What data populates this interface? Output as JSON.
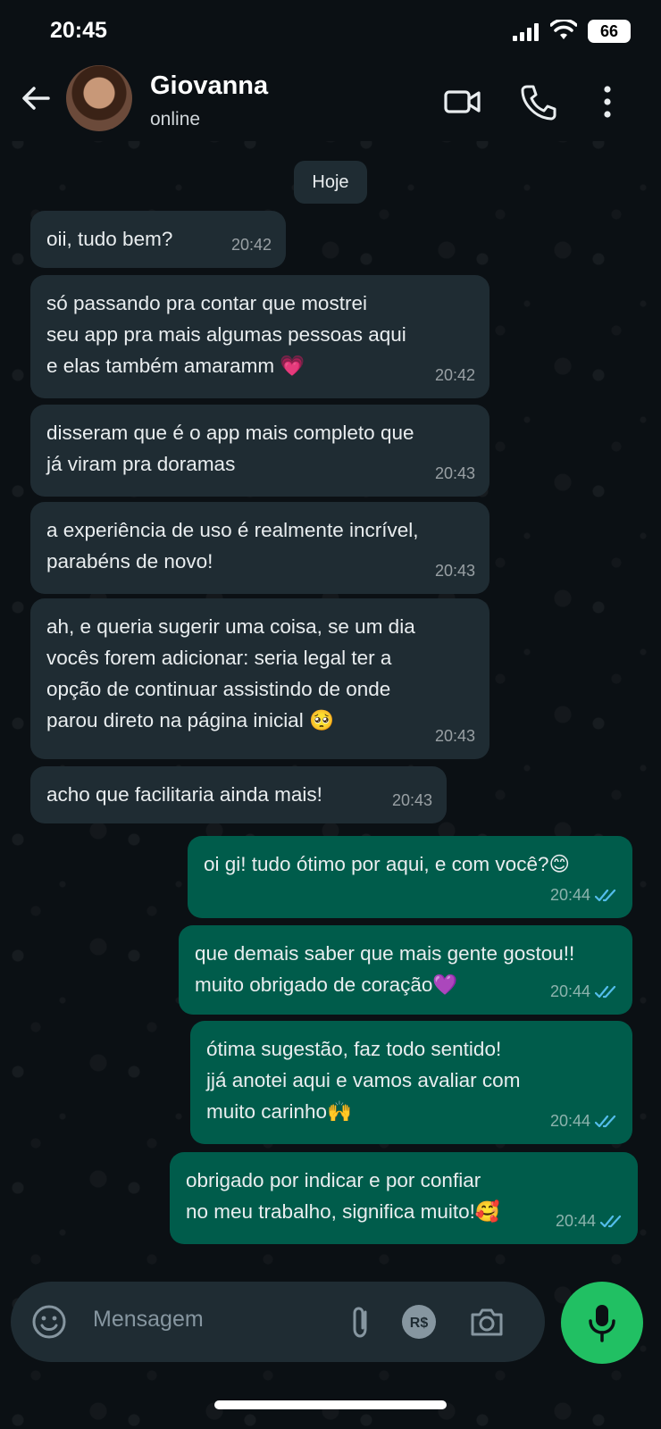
{
  "status_bar": {
    "time": "20:45",
    "battery": "66"
  },
  "header": {
    "contact_name": "Giovanna",
    "contact_status": "online"
  },
  "date_chip": "Hoje",
  "messages": [
    {
      "direction": "in",
      "text": "oii, tudo bem?",
      "time": "20:42"
    },
    {
      "direction": "in",
      "text": "só passando pra contar que mostrei\nseu app pra mais algumas pessoas aqui\ne elas também amaramm 💗",
      "time": "20:42"
    },
    {
      "direction": "in",
      "text": "disseram que é o app mais completo que\njá viram pra doramas",
      "time": "20:43"
    },
    {
      "direction": "in",
      "text": "a experiência de uso é realmente incrível,\nparabéns de novo!",
      "time": "20:43"
    },
    {
      "direction": "in",
      "text": "ah, e queria sugerir uma coisa, se um dia\nvocês forem adicionar: seria legal ter a\nopção de continuar assistindo de onde\nparou direto na página inicial 🥺",
      "time": "20:43"
    },
    {
      "direction": "in",
      "text": "acho que facilitaria ainda mais!",
      "time": "20:43"
    },
    {
      "direction": "out",
      "text": "oi gi! tudo ótimo por aqui, e com você?😊",
      "time": "20:44",
      "status": "read"
    },
    {
      "direction": "out",
      "text": "que demais saber que mais gente gostou!!\nmuito obrigado de coração💜",
      "time": "20:44",
      "status": "read"
    },
    {
      "direction": "out",
      "text": "ótima sugestão, faz todo sentido!\njjá anotei aqui e vamos avaliar com\nmuito carinho🙌",
      "time": "20:44",
      "status": "read"
    },
    {
      "direction": "out",
      "text": "obrigado por indicar e por confiar\nno meu trabalho, significa muito!🥰",
      "time": "20:44",
      "status": "read"
    }
  ],
  "composer": {
    "placeholder": "Mensagem"
  },
  "colors": {
    "background": "#0b1014",
    "incoming_bubble": "#1f2c33",
    "outgoing_bubble": "#005c4b",
    "mic_button": "#21c063",
    "read_ticks": "#53bdeb"
  },
  "icons": {
    "header": [
      "back-arrow-icon",
      "video-call-icon",
      "phone-icon",
      "more-options-icon"
    ],
    "composer": [
      "emoji-icon",
      "attach-icon",
      "payment-icon",
      "camera-icon",
      "mic-icon"
    ]
  }
}
